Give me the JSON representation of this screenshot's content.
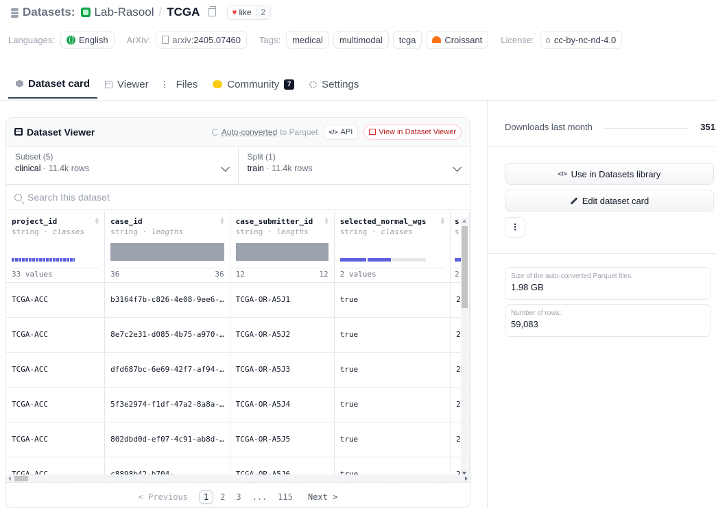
{
  "header": {
    "label": "Datasets:",
    "org": "Lab-Rasool",
    "separator": "/",
    "name": "TCGA",
    "like_label": "like",
    "like_count": "2"
  },
  "meta": {
    "languages_label": "Languages:",
    "language": "English",
    "arxiv_label": "ArXiv:",
    "arxiv_prefix": "arxiv:",
    "arxiv_id": "2405.07460",
    "tags_label": "Tags:",
    "tags": [
      "medical",
      "multimodal",
      "tcga"
    ],
    "croissant": "Croissant",
    "license_label": "License:",
    "license": "cc-by-nc-nd-4.0"
  },
  "tabs": [
    {
      "label": "Dataset card",
      "icon": "dataset-card-icon"
    },
    {
      "label": "Viewer",
      "icon": "viewer-icon"
    },
    {
      "label": "Files",
      "icon": "files-icon"
    },
    {
      "label": "Community",
      "icon": "community-icon",
      "badge": "7"
    },
    {
      "label": "Settings",
      "icon": "gear-icon"
    }
  ],
  "viewer": {
    "title": "Dataset Viewer",
    "autoconv_link": "Auto-converted",
    "autoconv_rest": "to Parquet",
    "api_label": "API",
    "open_label": "View in Dataset Viewer",
    "subset_label": "Subset (5)",
    "subset_value": "clinical",
    "subset_rows": "11.4k rows",
    "split_label": "Split (1)",
    "split_value": "train",
    "split_rows": "11.4k rows",
    "search_placeholder": "Search this dataset",
    "columns": [
      {
        "name": "project_id",
        "type": "string",
        "kind": "classes",
        "stat_left": "33 values",
        "stat_right": ""
      },
      {
        "name": "case_id",
        "type": "string",
        "kind": "lengths",
        "stat_left": "36",
        "stat_right": "36"
      },
      {
        "name": "case_submitter_id",
        "type": "string",
        "kind": "lengths",
        "stat_left": "12",
        "stat_right": "12"
      },
      {
        "name": "selected_normal_wgs",
        "type": "string",
        "kind": "classes",
        "stat_left": "2 values",
        "stat_right": ""
      },
      {
        "name": "s",
        "type": "s",
        "kind": "",
        "stat_left": "2",
        "stat_right": ""
      }
    ],
    "rows": [
      [
        "TCGA-ACC",
        "b3164f7b-c826-4e08-9ee6-…",
        "TCGA-OR-A5J1",
        "true",
        "2"
      ],
      [
        "TCGA-ACC",
        "8e7c2e31-d085-4b75-a970-…",
        "TCGA-OR-A5J2",
        "true",
        "2"
      ],
      [
        "TCGA-ACC",
        "dfd687bc-6e69-42f7-af94-…",
        "TCGA-OR-A5J3",
        "true",
        "2"
      ],
      [
        "TCGA-ACC",
        "5f3e2974-f1df-47a2-8a8a-…",
        "TCGA-OR-A5J4",
        "true",
        "2"
      ],
      [
        "TCGA-ACC",
        "802dbd0d-ef07-4c91-ab8d-…",
        "TCGA-OR-A5J5",
        "true",
        "2"
      ],
      [
        "TCGA-ACC",
        "c8898b42-b704-",
        "TCGA-OR-A5J6",
        "true",
        "2"
      ]
    ],
    "pagination": {
      "prev": "< Previous",
      "pages": [
        "1",
        "2",
        "3",
        "...",
        "115"
      ],
      "current": "1",
      "next": "Next >"
    }
  },
  "sidebar": {
    "downloads_label": "Downloads last month",
    "downloads_value": "351",
    "use_library": "Use in Datasets library",
    "edit_card": "Edit dataset card",
    "more": "⋮",
    "parquet_size_label": "Size of the auto-converted Parquet files:",
    "parquet_size": "1.98 GB",
    "rows_label": "Number of rows:",
    "rows_value": "59,083"
  },
  "colors": {
    "accent_blue": "#5b5fe0",
    "like_red": "#ef4444",
    "view_red": "#dc2626",
    "org_green": "#16a34a"
  }
}
